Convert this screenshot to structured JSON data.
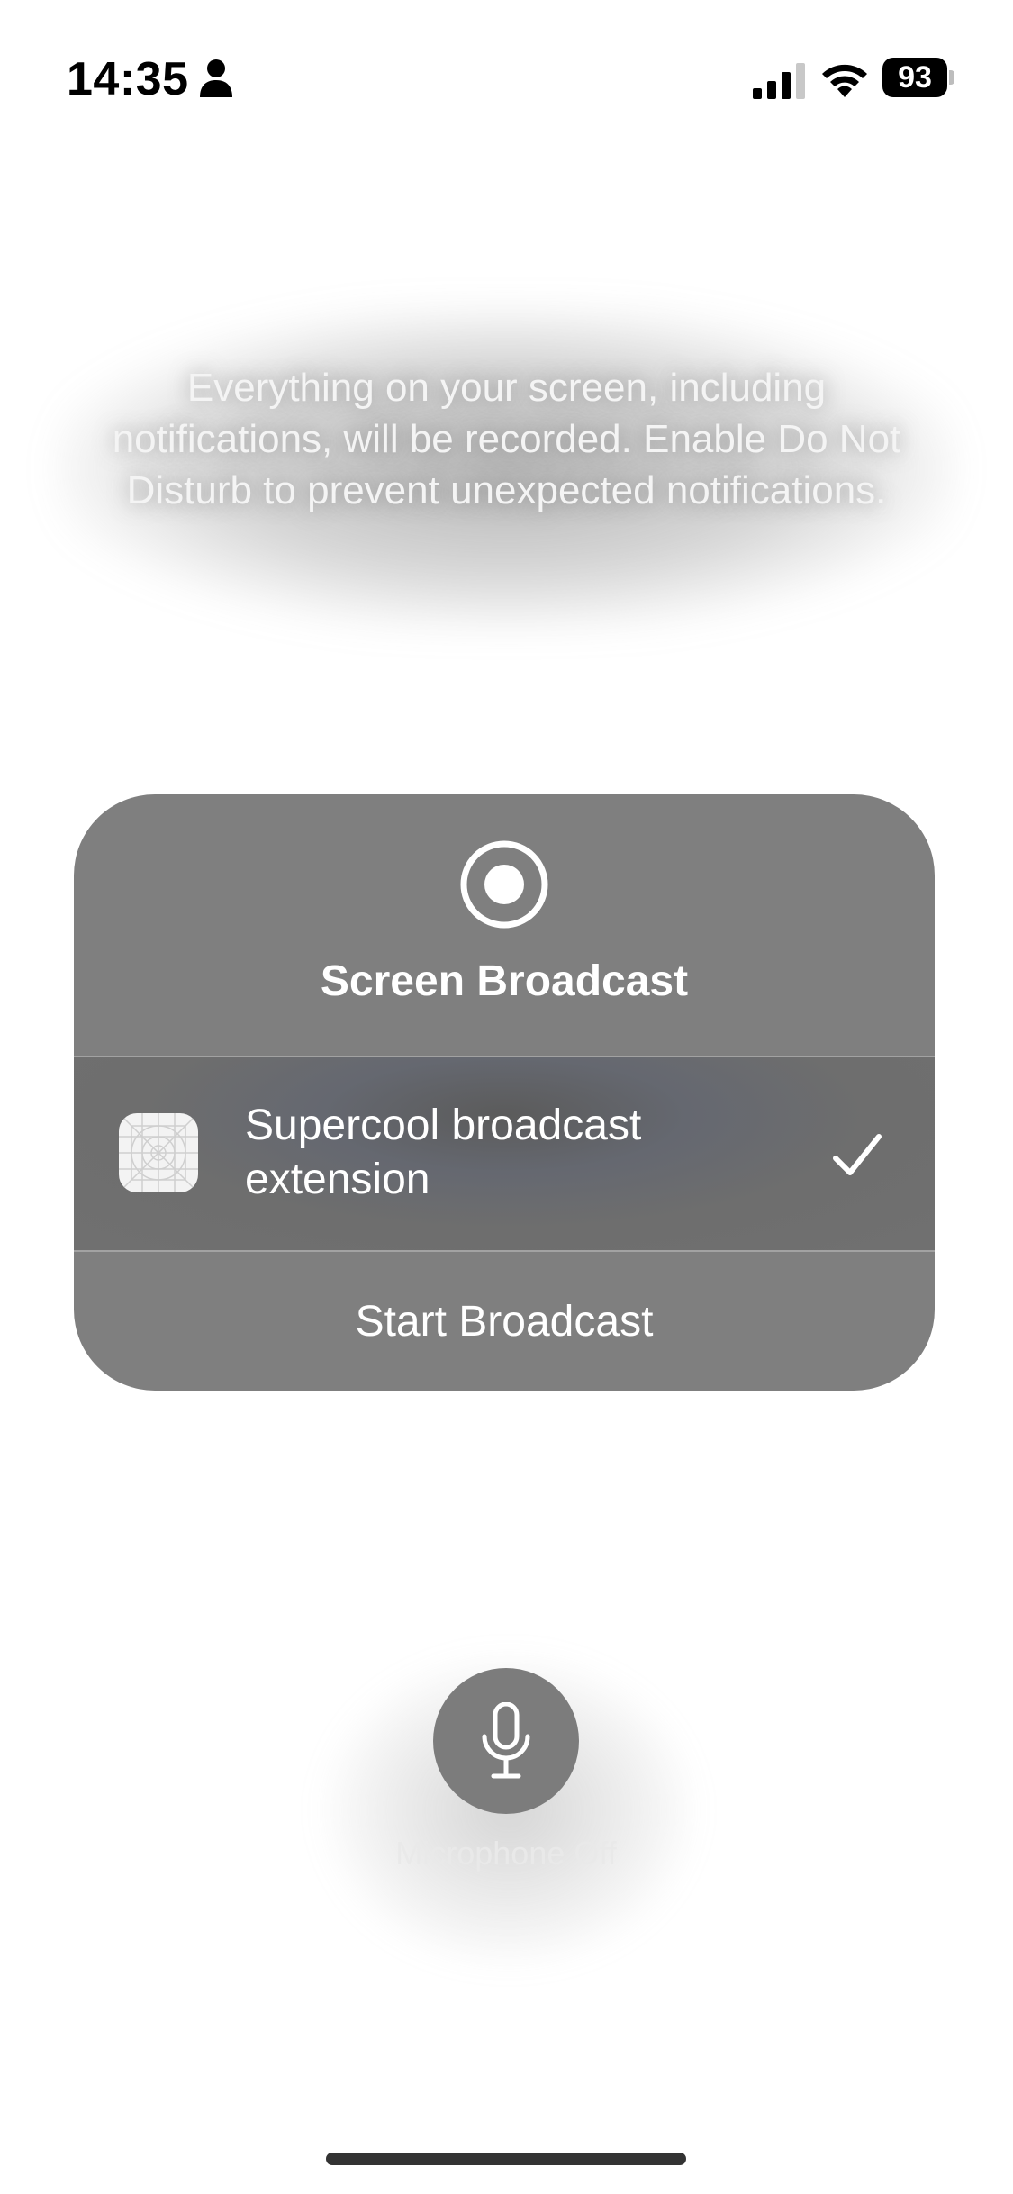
{
  "status_bar": {
    "time": "14:35",
    "battery_percent": "93",
    "signal_bars_active": 3,
    "signal_bars_total": 4
  },
  "notice": {
    "text": "Everything on your screen, including notifications, will be recorded. Enable Do Not Disturb to prevent unexpected notifications."
  },
  "broadcast_panel": {
    "title": "Screen Broadcast",
    "extension": {
      "name": "Supercool broadcast extension",
      "selected": true
    },
    "start_button_label": "Start Broadcast"
  },
  "microphone": {
    "label": "Microphone Off"
  },
  "colors": {
    "card": "#7f7f7f",
    "selected_row": "#6e6e6e",
    "mic_button": "#7c7c7c"
  },
  "icons": [
    "person-icon",
    "signal-icon",
    "wifi-icon",
    "battery-icon",
    "record-icon",
    "app-placeholder-icon",
    "checkmark-icon",
    "microphone-icon"
  ]
}
